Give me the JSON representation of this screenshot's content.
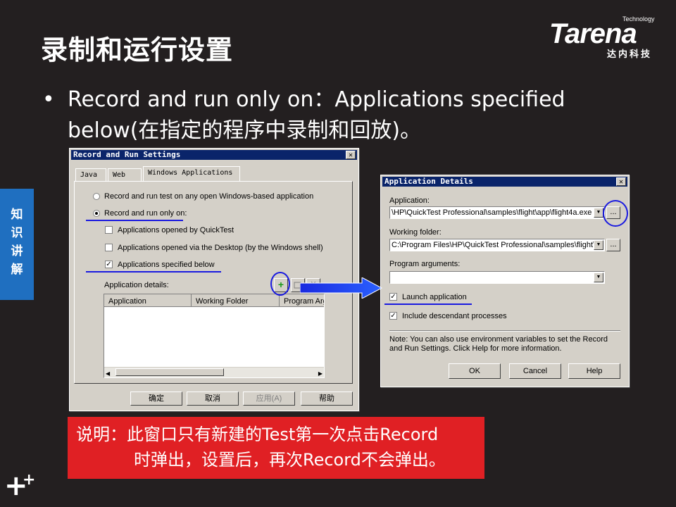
{
  "slide": {
    "title": "录制和运行设置",
    "bullet_dot": "•",
    "bullet_text": "Record and run only on：Applications specified below(在指定的程序中录制和回放)。",
    "side_tab": [
      "知",
      "识",
      "讲",
      "解"
    ],
    "note_line1": "说明：此窗口只有新建的Test第一次点击Record",
    "note_line2": "时弹出，设置后，再次Record不会弹出。"
  },
  "logo": {
    "main": "Tarena",
    "sup": "Technology",
    "sub": "达内科技"
  },
  "record_dialog": {
    "title": "Record and Run Settings",
    "close": "✕",
    "tabs": [
      "Java",
      "Web",
      "Windows Applications"
    ],
    "radio_any": "Record and run test on any open Windows-based application",
    "radio_only": "Record and run only on:",
    "check_quicktest": "Applications opened by QuickTest",
    "check_desktop": "Applications opened via the Desktop (by the Windows shell)",
    "check_specified": "Applications specified below",
    "app_details_label": "Application details:",
    "add_icon": "+",
    "columns": [
      "Application",
      "Working Folder",
      "Program Arg"
    ],
    "buttons": {
      "ok": "确定",
      "cancel": "取消",
      "apply": "应用(A)",
      "help": "帮助"
    },
    "check_mark": "✓"
  },
  "app_dialog": {
    "title": "Application Details",
    "close": "✕",
    "application_label": "Application:",
    "application_value": "\\HP\\QuickTest Professional\\samples\\flight\\app\\flight4a.exe",
    "working_folder_label": "Working folder:",
    "working_folder_value": "C:\\Program Files\\HP\\QuickTest Professional\\samples\\flight\\",
    "program_args_label": "Program arguments:",
    "program_args_value": "",
    "launch_label": "Launch application",
    "include_label": "Include descendant processes",
    "browse": "...",
    "dropdown_arrow": "▼",
    "note": "Note: You can also use environment variables to set the Record and Run Settings. Click Help for more information.",
    "buttons": {
      "ok": "OK",
      "cancel": "Cancel",
      "help": "Help"
    },
    "check_mark": "✓"
  },
  "colors": {
    "background": "#231f20",
    "highlight": "#1a1ae0",
    "note_bg": "#e02024",
    "side_tab": "#1f6fc0"
  }
}
